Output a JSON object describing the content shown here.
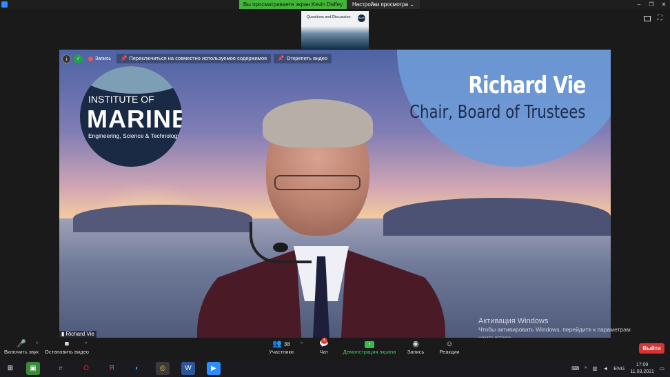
{
  "window": {
    "share_banner": "Вы просматриваете экран Kevin Daffey",
    "view_options": "Настройки просмотра",
    "minimize": "–",
    "maximize": "❐",
    "close": "✕",
    "fullscreen_glyph": "⛶"
  },
  "thumbnail": {
    "title": "Questions and Discussion",
    "logo": "IMarEST"
  },
  "video_toolbar": {
    "info_glyph": "i",
    "shield_glyph": "✓",
    "recording_label": "Запись",
    "switch_content": "Переключиться на совместно используемое содержимое",
    "unpin_video": "Открепить видео"
  },
  "slide": {
    "name": "Richard Vie",
    "role": "Chair, Board of Trustees",
    "logo": {
      "line1": "INSTITUTE OF",
      "line2": "MARINE",
      "line3": "Engineering, Science & Technology"
    }
  },
  "participant_label": "Richard Vie",
  "activation": {
    "title": "Активация Windows",
    "text": "Чтобы активировать Windows, перейдите к параметрам компьютера."
  },
  "toolbar": {
    "audio": "Включить звук",
    "video": "Остановить видео",
    "participants": "Участники",
    "participants_count": "38",
    "chat": "Чат",
    "chat_badge": "4",
    "share": "Демонстрация экрана",
    "record": "Запись",
    "reactions": "Реакции",
    "leave": "Выйти"
  },
  "taskbar": {
    "lang": "ENG",
    "time": "17:09",
    "date": "11.03.2021"
  },
  "colors": {
    "share_green": "#43b53a",
    "leave_red": "#d93434",
    "zoom_blue": "#2d8cff"
  },
  "icons": [
    "microphone-muted-icon",
    "camera-icon",
    "participants-icon",
    "chat-icon",
    "share-screen-icon",
    "record-icon",
    "reactions-icon"
  ]
}
